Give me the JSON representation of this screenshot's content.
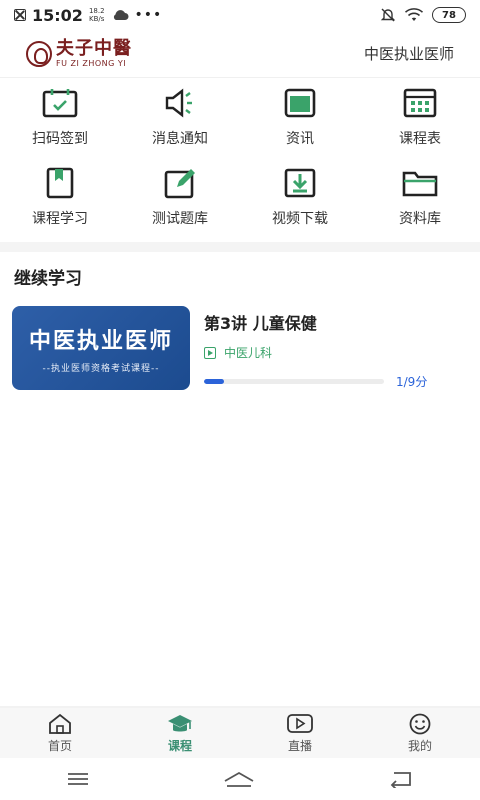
{
  "status_bar": {
    "time": "15:02",
    "speed_value": "18.2",
    "speed_unit": "KB/s",
    "dots": "•••",
    "battery": "78"
  },
  "header": {
    "logo_cn": "夫子中醫",
    "logo_en": "FU ZI ZHONG YI",
    "subject": "中医执业医师"
  },
  "grid": [
    {
      "label": "扫码签到",
      "icon": "calendar-check-icon"
    },
    {
      "label": "消息通知",
      "icon": "speaker-icon"
    },
    {
      "label": "资讯",
      "icon": "news-icon"
    },
    {
      "label": "课程表",
      "icon": "schedule-icon"
    },
    {
      "label": "课程学习",
      "icon": "bookmark-icon"
    },
    {
      "label": "测试题库",
      "icon": "edit-icon"
    },
    {
      "label": "视频下载",
      "icon": "download-icon"
    },
    {
      "label": "资料库",
      "icon": "folder-icon"
    }
  ],
  "continue": {
    "title": "继续学习",
    "course": {
      "thumb_title": "中医执业医师",
      "thumb_sub": "--执业医师资格考试课程--",
      "title": "第3讲 儿童保健",
      "tag": "中医儿科",
      "progress": 0.11,
      "progress_text": "1/9分"
    }
  },
  "tabs": [
    {
      "label": "首页",
      "icon": "home-icon",
      "active": false
    },
    {
      "label": "课程",
      "icon": "graduation-cap-icon",
      "active": true
    },
    {
      "label": "直播",
      "icon": "video-play-icon",
      "active": false
    },
    {
      "label": "我的",
      "icon": "smile-icon",
      "active": false
    }
  ],
  "colors": {
    "accent": "#3a8f73",
    "progress": "#2b63d9",
    "brand": "#7a1f1f",
    "icon_green": "#3aa36a"
  }
}
